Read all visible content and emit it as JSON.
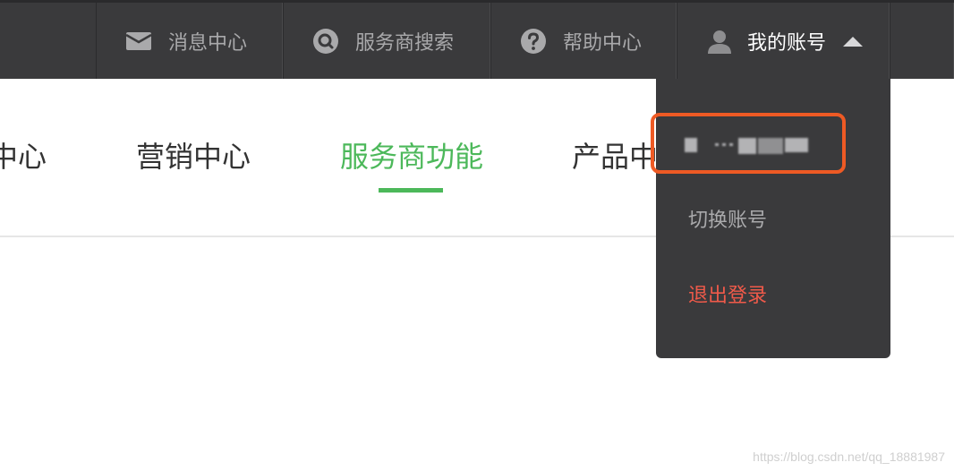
{
  "topbar": {
    "items": [
      {
        "label": "消息中心",
        "icon": "mail-icon"
      },
      {
        "label": "服务商搜索",
        "icon": "search-icon"
      },
      {
        "label": "帮助中心",
        "icon": "help-icon"
      },
      {
        "label": "我的账号",
        "icon": "user-icon"
      }
    ]
  },
  "nav": {
    "tabs": [
      {
        "label": "中心"
      },
      {
        "label": "营销中心"
      },
      {
        "label": "服务商功能",
        "active": true
      },
      {
        "label": "产品中"
      }
    ]
  },
  "dropdown": {
    "items": [
      {
        "label": "切换账号"
      },
      {
        "label": "退出登录"
      }
    ]
  },
  "watermark": "https://blog.csdn.net/qq_18881987",
  "colors": {
    "topbar_bg": "#3a3a3c",
    "accent_green": "#4cb85a",
    "logout_red": "#f05a4a",
    "highlight_orange": "#ee5a24"
  }
}
